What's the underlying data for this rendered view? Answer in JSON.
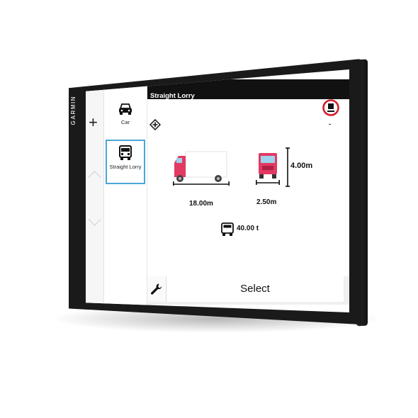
{
  "device": {
    "brand": "GARMIN"
  },
  "header": {
    "title": "Straight Lorry"
  },
  "sidebar": {
    "add_icon": "plus-icon",
    "up_icon": "chevron-up-icon",
    "down_icon": "chevron-down-icon"
  },
  "vehicles": [
    {
      "label": "Car",
      "icon": "car-icon",
      "selected": false
    },
    {
      "label": "Straight Lorry",
      "icon": "lorry-icon",
      "selected": true
    }
  ],
  "dimensions": {
    "length": "18.00m",
    "width": "2.50m",
    "height": "4.00m",
    "weight": "40.00 t"
  },
  "restriction": {
    "label": "-",
    "icon": "trailer-restriction-icon"
  },
  "hazmat_icon": "hazmat-diamond-icon",
  "footer": {
    "select_label": "Select",
    "settings_icon": "wrench-icon"
  },
  "colors": {
    "truck_red": "#e23a62",
    "selected_border": "#4aa6d6",
    "header_bg": "#111111"
  }
}
